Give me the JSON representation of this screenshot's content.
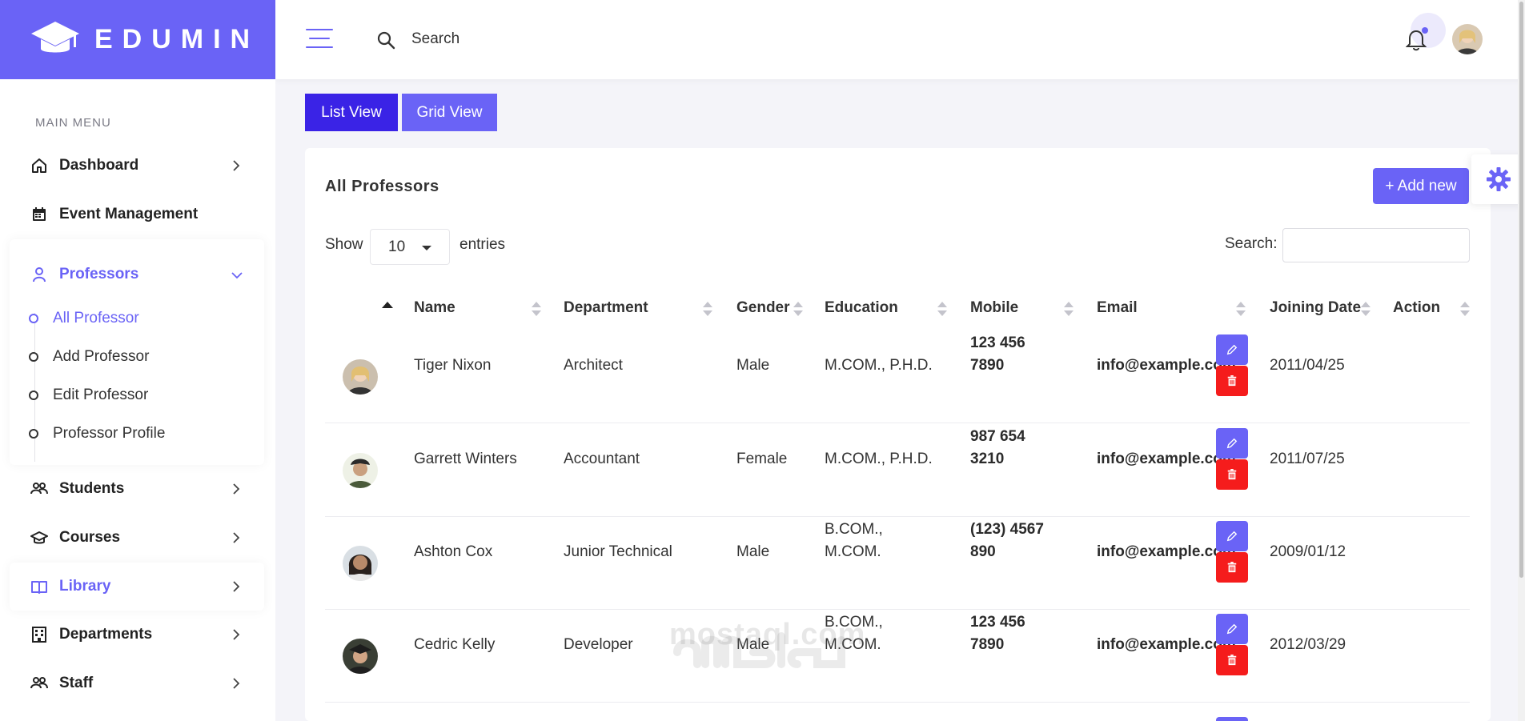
{
  "brand": {
    "name": "EDUMIN"
  },
  "topbar": {
    "search_placeholder": "Search"
  },
  "sidebar": {
    "menu_title": "MAIN MENU",
    "items": [
      {
        "label": "Dashboard",
        "icon": "home-icon"
      },
      {
        "label": "Event Management",
        "icon": "calendar-icon"
      },
      {
        "label": "Professors",
        "icon": "user-icon",
        "expanded": true
      },
      {
        "label": "Students",
        "icon": "users-icon"
      },
      {
        "label": "Courses",
        "icon": "graduation-cap-icon"
      },
      {
        "label": "Library",
        "icon": "book-icon"
      },
      {
        "label": "Departments",
        "icon": "building-icon"
      },
      {
        "label": "Staff",
        "icon": "users-icon"
      }
    ],
    "professor_sub": [
      "All Professor",
      "Add Professor",
      "Edit Professor",
      "Professor Profile"
    ]
  },
  "views": {
    "list": "List View",
    "grid": "Grid View"
  },
  "card": {
    "title": "All Professors",
    "add_label": "+ Add new",
    "show_label": "Show",
    "entries_value": "10",
    "entries_label": "entries",
    "search_label": "Search:"
  },
  "table": {
    "headers": [
      "Name",
      "Department",
      "Gender",
      "Education",
      "Mobile",
      "Email",
      "Joining Date",
      "Action"
    ],
    "rows": [
      {
        "name": "Tiger Nixon",
        "department": "Architect",
        "gender": "Male",
        "education": [
          "M.COM., P.H.D."
        ],
        "mobile": [
          "123 456",
          "7890"
        ],
        "email": "info@example.com",
        "joining": "2011/04/25"
      },
      {
        "name": "Garrett Winters",
        "department": "Accountant",
        "gender": "Female",
        "education": [
          "M.COM., P.H.D."
        ],
        "mobile": [
          "987 654",
          "3210"
        ],
        "email": "info@example.com",
        "joining": "2011/07/25"
      },
      {
        "name": "Ashton Cox",
        "department": "Junior Technical",
        "gender": "Male",
        "education": [
          "B.COM.,",
          "M.COM."
        ],
        "mobile": [
          "(123) 4567",
          "890"
        ],
        "email": "info@example.com",
        "joining": "2009/01/12"
      },
      {
        "name": "Cedric Kelly",
        "department": "Developer",
        "gender": "Male",
        "education": [
          "B.COM.,",
          "M.COM."
        ],
        "mobile": [
          "123 456",
          "7890"
        ],
        "email": "info@example.com",
        "joining": "2012/03/29"
      }
    ]
  },
  "watermark": {
    "text": "mostaql.com"
  },
  "colors": {
    "accent": "#6a63f6",
    "dark_accent": "#3a23e6",
    "danger": "#f51c1c"
  }
}
